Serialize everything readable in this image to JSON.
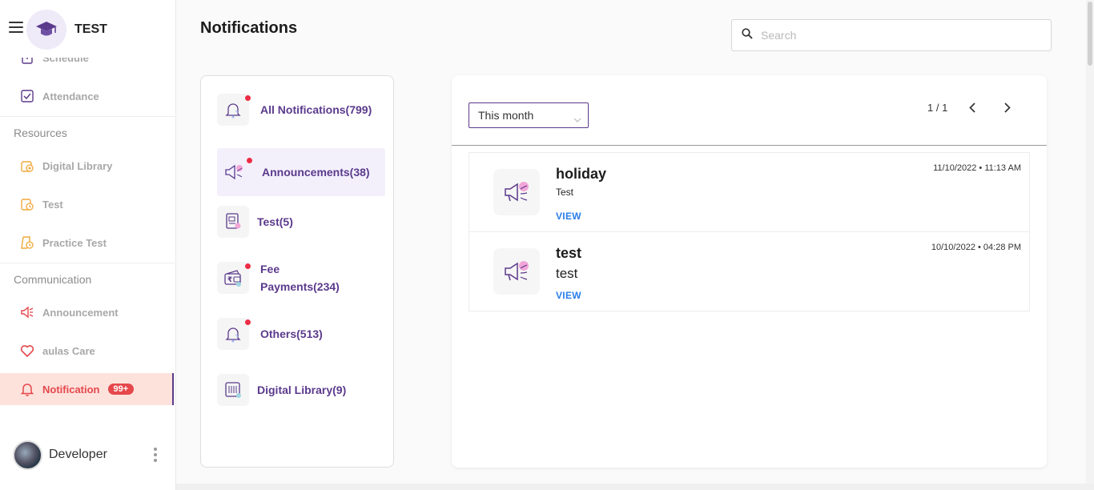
{
  "brand": {
    "name": "TEST"
  },
  "sidebar": {
    "items": [
      {
        "label": "Schedule",
        "icon": "calendar-icon"
      },
      {
        "label": "Attendance",
        "icon": "checkbox-icon"
      },
      {
        "label": "Digital Library",
        "icon": "library-icon"
      },
      {
        "label": "Test",
        "icon": "test-clock-icon"
      },
      {
        "label": "Practice Test",
        "icon": "practice-test-icon"
      },
      {
        "label": "Announcement",
        "icon": "megaphone-icon"
      },
      {
        "label": "aulas Care",
        "icon": "heart-icon"
      },
      {
        "label": "Notification",
        "icon": "bell-icon",
        "badge": "99+",
        "active": true
      }
    ],
    "sections": {
      "resources": "Resources",
      "communication": "Communication"
    },
    "user": {
      "name": "Developer"
    }
  },
  "main": {
    "title": "Notifications",
    "search": {
      "placeholder": "Search",
      "value": ""
    },
    "categories": [
      {
        "label": "All Notifications(799)",
        "icon": "bell-icon",
        "unread": true
      },
      {
        "label": "Announcements(38)",
        "icon": "megaphone-icon",
        "unread": true,
        "selected": true
      },
      {
        "label": "Test(5)",
        "icon": "test-paper-icon",
        "unread": false
      },
      {
        "label": "Fee Payments(234)",
        "icon": "wallet-icon",
        "unread": true
      },
      {
        "label": "Others(513)",
        "icon": "bell-icon",
        "unread": true
      },
      {
        "label": "Digital Library(9)",
        "icon": "library-icon",
        "unread": false
      }
    ],
    "filter": {
      "selected": "This month"
    },
    "pagination": {
      "text": "1 / 1"
    },
    "notifications": [
      {
        "title": "holiday",
        "body": "Test",
        "view": "VIEW",
        "time": "11/10/2022 • 11:13 AM"
      },
      {
        "title": "test",
        "body": "test",
        "view": "VIEW",
        "time": "10/10/2022 • 04:28 PM"
      }
    ]
  },
  "colors": {
    "accent": "#5b3a8c",
    "alert": "#e5474b",
    "link": "#2b7de9",
    "resource_icon": "#f0a93b"
  }
}
